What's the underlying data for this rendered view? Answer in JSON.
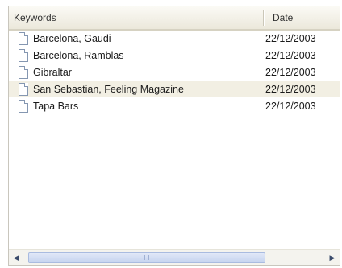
{
  "list": {
    "columns": {
      "keywords": "Keywords",
      "date": "Date"
    },
    "rows": [
      {
        "keywords": "Barcelona, Gaudi",
        "date": "22/12/2003",
        "selected": false
      },
      {
        "keywords": "Barcelona, Ramblas",
        "date": "22/12/2003",
        "selected": false
      },
      {
        "keywords": "Gibraltar",
        "date": "22/12/2003",
        "selected": false
      },
      {
        "keywords": "San Sebastian, Feeling Magazine",
        "date": "22/12/2003",
        "selected": true
      },
      {
        "keywords": "Tapa Bars",
        "date": "22/12/2003",
        "selected": false
      }
    ],
    "row_icon": "document-icon",
    "scrollbar": {
      "left_arrow": "◀",
      "right_arrow": "▶"
    },
    "colors": {
      "selected_row": "#f2efe3",
      "header": "#ebe8db",
      "scroll_thumb": "#c5d3ef"
    }
  }
}
